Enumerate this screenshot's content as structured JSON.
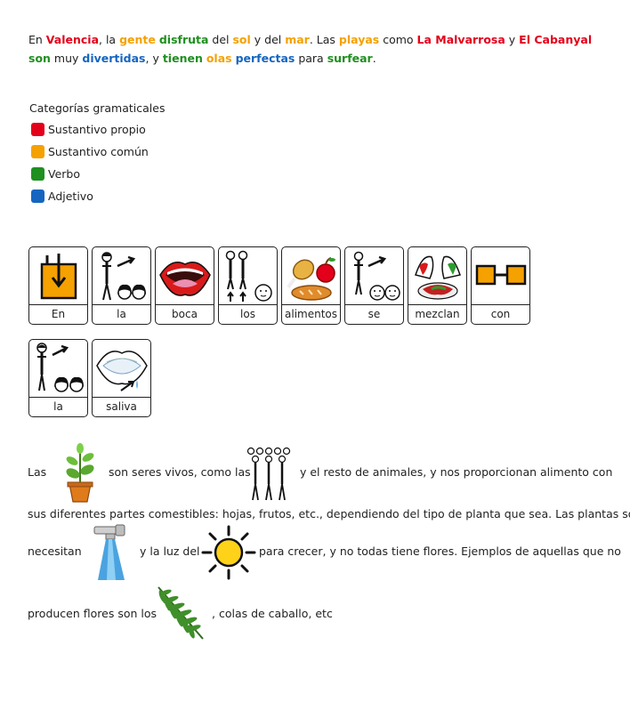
{
  "sentence": [
    {
      "text": "En ",
      "cat": ""
    },
    {
      "text": "Valencia",
      "cat": "red"
    },
    {
      "text": ", la ",
      "cat": ""
    },
    {
      "text": "gente",
      "cat": "orange"
    },
    {
      "text": " ",
      "cat": ""
    },
    {
      "text": "disfruta",
      "cat": "green"
    },
    {
      "text": " del ",
      "cat": ""
    },
    {
      "text": "sol",
      "cat": "orange"
    },
    {
      "text": " y del ",
      "cat": ""
    },
    {
      "text": "mar",
      "cat": "orange"
    },
    {
      "text": ". Las ",
      "cat": ""
    },
    {
      "text": "playas",
      "cat": "orange"
    },
    {
      "text": " como ",
      "cat": ""
    },
    {
      "text": "La Malvarrosa",
      "cat": "red"
    },
    {
      "text": " y ",
      "cat": ""
    },
    {
      "text": "El Cabanyal",
      "cat": "red"
    },
    {
      "text": " ",
      "cat": ""
    },
    {
      "text": "son",
      "cat": "green"
    },
    {
      "text": " muy ",
      "cat": ""
    },
    {
      "text": "divertidas",
      "cat": "blue"
    },
    {
      "text": ", y ",
      "cat": ""
    },
    {
      "text": "tienen",
      "cat": "green"
    },
    {
      "text": " ",
      "cat": ""
    },
    {
      "text": "olas",
      "cat": "orange"
    },
    {
      "text": " ",
      "cat": ""
    },
    {
      "text": "perfectas",
      "cat": "blue"
    },
    {
      "text": " para ",
      "cat": ""
    },
    {
      "text": "surfear",
      "cat": "green"
    },
    {
      "text": ".",
      "cat": ""
    }
  ],
  "legend": {
    "title": "Categorías gramaticales",
    "items": [
      {
        "label": "Sustantivo propio",
        "color": "#e3001b"
      },
      {
        "label": "Sustantivo común",
        "color": "#f5a100"
      },
      {
        "label": "Verbo",
        "color": "#1f8f1f"
      },
      {
        "label": "Adjetivo",
        "color": "#1565c0"
      }
    ]
  },
  "pictograms": {
    "row1": [
      {
        "label": "En",
        "icon": "in-box-icon"
      },
      {
        "label": "la",
        "icon": "the-feminine-icon"
      },
      {
        "label": "boca",
        "icon": "mouth-icon"
      },
      {
        "label": "los",
        "icon": "the-masculine-plural-icon"
      },
      {
        "label": "alimentos",
        "icon": "food-icon"
      },
      {
        "label": "se",
        "icon": "reflexive-icon"
      },
      {
        "label": "mezclan",
        "icon": "mix-icon"
      },
      {
        "label": "con",
        "icon": "with-icon"
      }
    ],
    "row2": [
      {
        "label": "la",
        "icon": "the-feminine-icon"
      },
      {
        "label": "saliva",
        "icon": "saliva-icon"
      }
    ]
  },
  "paragraph": {
    "l1a": "Las",
    "l1b": "son seres vivos, como las",
    "l1c": "y el resto de animales, y nos proporcionan alimento con",
    "l2": "sus diferentes partes comestibles: hojas, frutos, etc., dependiendo del tipo de planta que sea. Las plantas solo",
    "l3a": "necesitan",
    "l3b": "y la luz del",
    "l3c": "para crecer, y no todas tiene flores. Ejemplos de aquellas que no",
    "l4a": "producen flores son los",
    "l4b": ", colas de caballo, etc",
    "icons": [
      "plant-icon",
      "people-icon",
      "water-tap-icon",
      "sun-icon",
      "fern-icon"
    ]
  }
}
